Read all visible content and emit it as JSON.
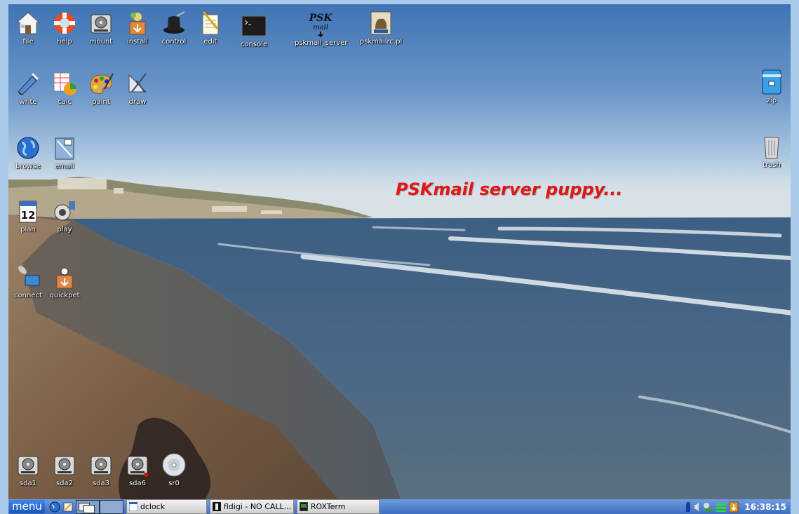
{
  "desktop": {
    "headline": "PSKmail server puppy...",
    "icons_top": [
      {
        "label": "file",
        "icon": "home-icon"
      },
      {
        "label": "help",
        "icon": "lifebuoy-icon"
      },
      {
        "label": "mount",
        "icon": "drive-icon"
      },
      {
        "label": "install",
        "icon": "package-icon"
      },
      {
        "label": "control",
        "icon": "tophat-icon"
      },
      {
        "label": "edit",
        "icon": "notepad-icon"
      },
      {
        "label": "console",
        "icon": "terminal-icon"
      },
      {
        "label": "pskmail_server",
        "icon": "pskmail-icon"
      },
      {
        "label": "pskmailrc.pl",
        "icon": "perl-camel-icon"
      }
    ],
    "icons_row2": [
      {
        "label": "write",
        "icon": "write-icon"
      },
      {
        "label": "calc",
        "icon": "spreadsheet-icon"
      },
      {
        "label": "paint",
        "icon": "palette-icon"
      },
      {
        "label": "draw",
        "icon": "draw-icon"
      }
    ],
    "icons_row3": [
      {
        "label": "browse",
        "icon": "globe-icon"
      },
      {
        "label": "email",
        "icon": "email-icon"
      }
    ],
    "icons_row4": [
      {
        "label": "plan",
        "icon": "calendar-icon",
        "badge": "12"
      },
      {
        "label": "play",
        "icon": "speaker-icon"
      }
    ],
    "icons_row5": [
      {
        "label": "connect",
        "icon": "network-icon"
      },
      {
        "label": "quickpet",
        "icon": "quickpet-icon"
      }
    ],
    "icons_right": [
      {
        "label": "zip",
        "icon": "archive-icon"
      },
      {
        "label": "trash",
        "icon": "trash-icon"
      }
    ],
    "drives": [
      {
        "label": "sda1",
        "icon": "drive-icon"
      },
      {
        "label": "sda2",
        "icon": "drive-icon"
      },
      {
        "label": "sda3",
        "icon": "drive-icon"
      },
      {
        "label": "sda6",
        "icon": "drive-icon"
      },
      {
        "label": "sr0",
        "icon": "cdrom-icon"
      }
    ]
  },
  "taskbar": {
    "menu_label": "menu",
    "tasks": [
      {
        "label": "dclock"
      },
      {
        "label": "fldigi - NO CALL..."
      },
      {
        "label": "ROXTerm"
      }
    ],
    "clock": "16:38:15"
  },
  "colors": {
    "headline": "#e21616",
    "taskbar": "#3e6fbf",
    "frame": "#a9cbe9"
  }
}
